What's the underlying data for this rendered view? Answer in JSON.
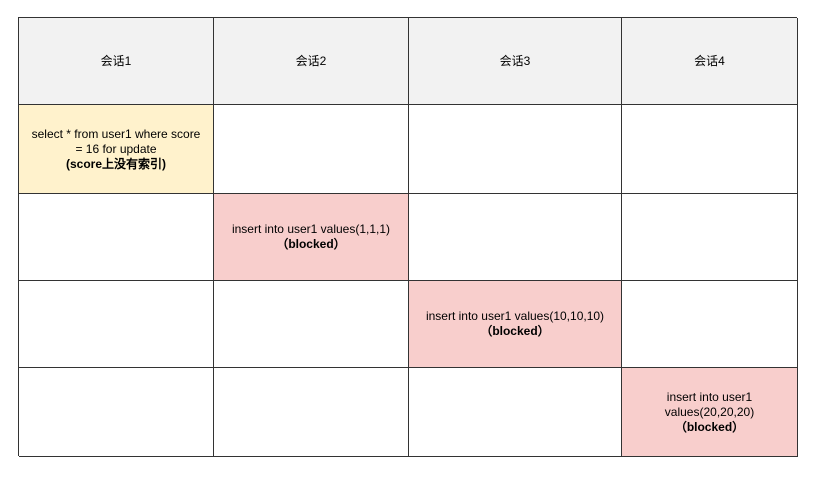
{
  "colors": {
    "header_bg": "#f2f2f2",
    "highlight_yellow": "#fff2cc",
    "blocked_pink": "#f8cecc",
    "border": "#333333"
  },
  "headers": [
    "会话1",
    "会话2",
    "会话3",
    "会话4"
  ],
  "session1": {
    "statement": "select * from user1 where score = 16 for update",
    "note": "(score上没有索引)"
  },
  "session2": {
    "statement": "insert into user1 values(1,1,1)",
    "status": "（blocked）"
  },
  "session3": {
    "statement": "insert into user1 values(10,10,10)",
    "status": "（blocked）"
  },
  "session4": {
    "statement": "insert into user1 values(20,20,20)",
    "status": "（blocked）"
  }
}
